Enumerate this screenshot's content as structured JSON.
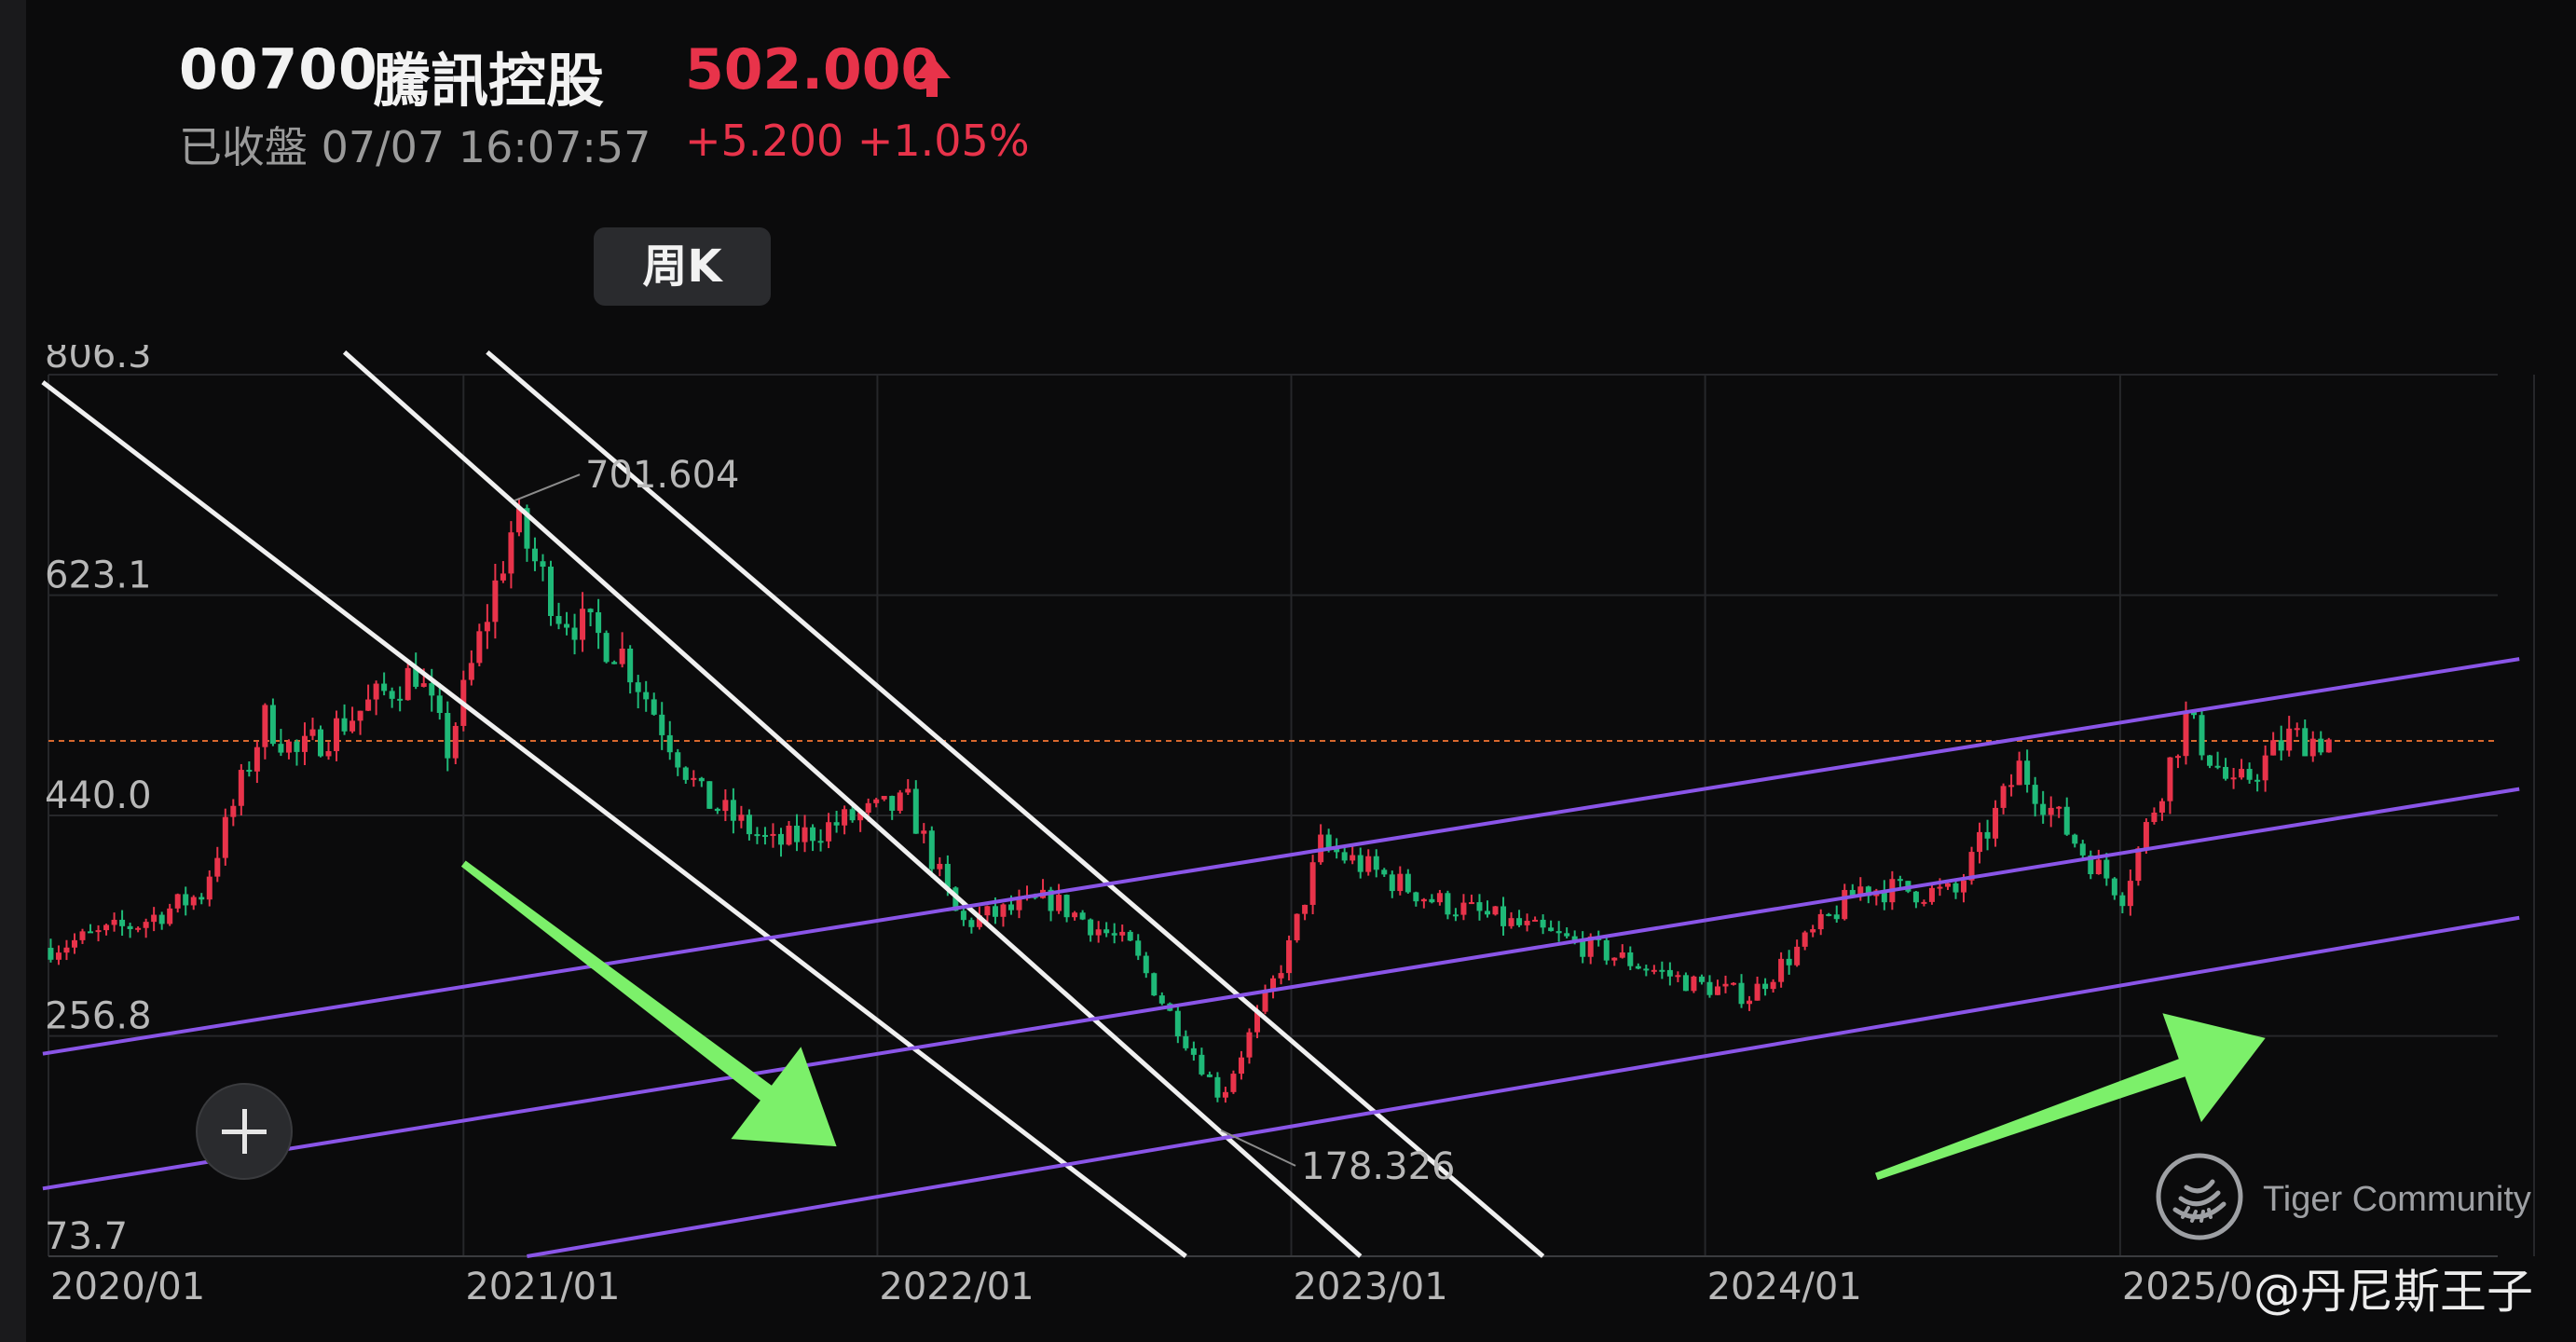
{
  "header": {
    "code": "00700",
    "name": "騰訊控股",
    "price": "502.000",
    "status": "已收盤 07/07 16:07:57",
    "change": "+5.200 +1.05%"
  },
  "period_button": "周K",
  "watermark": {
    "brand": "Tiger Community",
    "author": "@丹尼斯王子"
  },
  "icons": {
    "price_arrow": "arrow-up-icon",
    "add": "plus-icon",
    "logo": "tiger-logo-icon"
  },
  "colors": {
    "up": "#e8334a",
    "down": "#1fb978",
    "channel": "#8a55e8",
    "down_channel": "#f0f0f0",
    "arrow": "#7cf06a",
    "ref_line": "#d8682e"
  },
  "chart_data": {
    "type": "candlestick",
    "ylim": [
      73.7,
      806.3
    ],
    "y_ticks": [
      806.3,
      623.1,
      440.0,
      256.8,
      73.7
    ],
    "y_tick_labels": [
      "806.3",
      "623.1",
      "440.0",
      "256.8",
      "73.7"
    ],
    "x_labels": [
      "2020/01",
      "2021/01",
      "2022/01",
      "2023/01",
      "2024/01",
      "2025/0"
    ],
    "reference_price": 502.0,
    "annotations": [
      {
        "label": "701.604",
        "date": "2021-02-15",
        "value": 701.604
      },
      {
        "label": "178.326",
        "date": "2022-10-31",
        "value": 178.326
      }
    ],
    "weekly_close_anchors": [
      [
        "2020-01-03",
        330
      ],
      [
        "2020-03-20",
        350
      ],
      [
        "2020-05-15",
        375
      ],
      [
        "2020-07-10",
        520
      ],
      [
        "2020-08-07",
        490
      ],
      [
        "2020-11-20",
        560
      ],
      [
        "2020-12-18",
        495
      ],
      [
        "2021-02-15",
        685
      ],
      [
        "2021-03-26",
        610
      ],
      [
        "2021-05-21",
        575
      ],
      [
        "2021-07-30",
        455
      ],
      [
        "2021-10-01",
        415
      ],
      [
        "2021-12-17",
        440
      ],
      [
        "2022-01-28",
        450
      ],
      [
        "2022-03-15",
        350
      ],
      [
        "2022-06-03",
        370
      ],
      [
        "2022-08-12",
        330
      ],
      [
        "2022-10-31",
        205
      ],
      [
        "2022-12-30",
        330
      ],
      [
        "2023-01-27",
        415
      ],
      [
        "2023-05-05",
        370
      ],
      [
        "2023-09-22",
        330
      ],
      [
        "2023-12-22",
        300
      ],
      [
        "2024-02-09",
        290
      ],
      [
        "2024-05-17",
        380
      ],
      [
        "2024-08-09",
        375
      ],
      [
        "2024-10-04",
        480
      ],
      [
        "2024-11-29",
        410
      ],
      [
        "2025-01-03",
        375
      ],
      [
        "2025-02-28",
        520
      ],
      [
        "2025-04-11",
        460
      ],
      [
        "2025-05-30",
        505
      ],
      [
        "2025-07-07",
        502
      ]
    ],
    "lines": [
      {
        "style": "descending-channel",
        "from": [
          "2019-12-27",
          800
        ],
        "to": [
          "2022-09-30",
          73.7
        ]
      },
      {
        "style": "descending-channel",
        "from": [
          "2020-09-18",
          825
        ],
        "to": [
          "2023-03-03",
          73.7
        ]
      },
      {
        "style": "descending-channel",
        "from": [
          "2021-01-22",
          825
        ],
        "to": [
          "2023-08-11",
          73.7
        ]
      },
      {
        "style": "ascending-channel",
        "from": [
          "2019-12-27",
          242
        ],
        "to": [
          "2025-12-19",
          570
        ]
      },
      {
        "style": "ascending-channel",
        "from": [
          "2019-12-27",
          130
        ],
        "to": [
          "2025-12-19",
          462
        ]
      },
      {
        "style": "ascending-channel",
        "from": [
          "2021-02-26",
          73.7
        ],
        "to": [
          "2025-12-19",
          355
        ]
      }
    ],
    "trend_arrows": [
      {
        "direction": "down",
        "from": [
          "2021-01-01",
          400
        ],
        "to": [
          "2021-11-26",
          165
        ]
      },
      {
        "direction": "up",
        "from": [
          "2024-05-31",
          140
        ],
        "to": [
          "2025-05-09",
          255
        ]
      }
    ]
  }
}
